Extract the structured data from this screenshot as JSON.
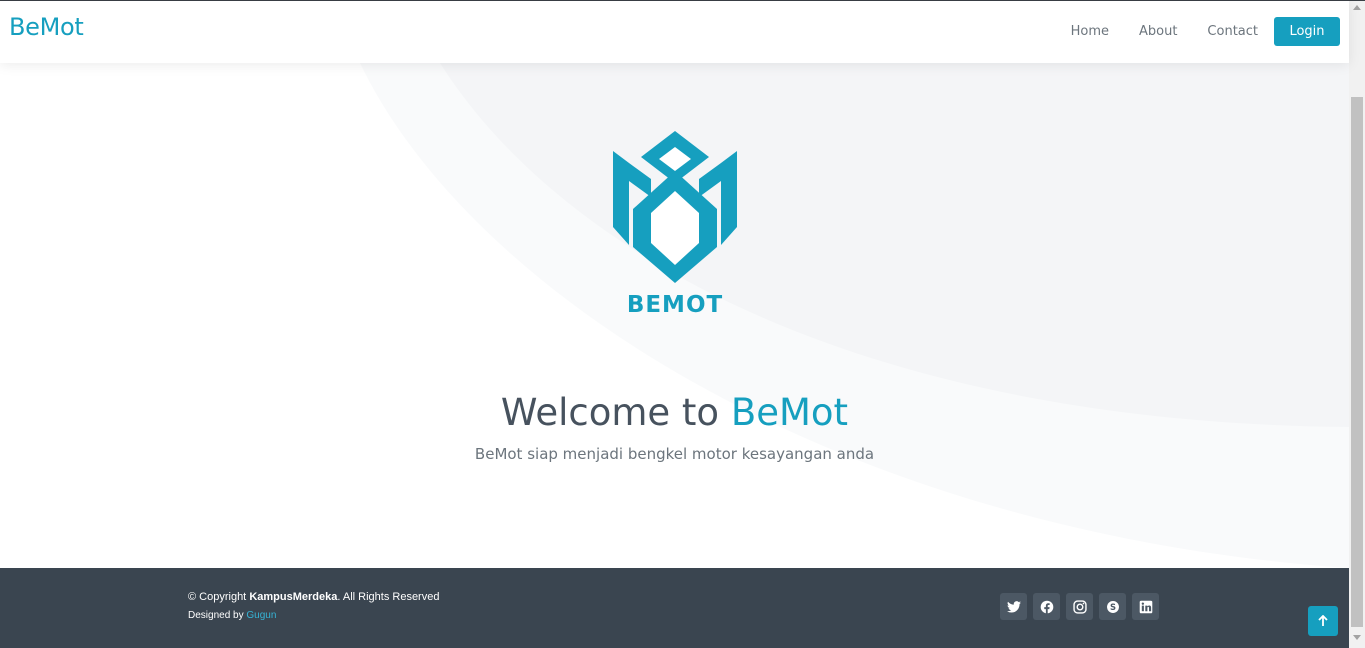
{
  "header": {
    "brand": "BeMot",
    "nav": [
      "Home",
      "About",
      "Contact"
    ],
    "login_label": "Login"
  },
  "hero": {
    "logo_text": "BEMOT",
    "welcome_prefix": "Welcome to",
    "welcome_accent": "BeMot",
    "subtitle": "BeMot siap menjadi bengkel motor kesayangan anda"
  },
  "footer": {
    "copyright_prefix": "© Copyright",
    "copyright_name": "KampusMerdeka",
    "copyright_suffix": ". All Rights Reserved",
    "designed_prefix": "Designed by",
    "designed_link": "Gugun",
    "socials": [
      "twitter-icon",
      "facebook-icon",
      "instagram-icon",
      "skype-icon",
      "linkedin-icon"
    ]
  },
  "colors": {
    "accent": "#169fbf",
    "footer_bg": "#3a4550",
    "text_dark": "#47525e"
  }
}
